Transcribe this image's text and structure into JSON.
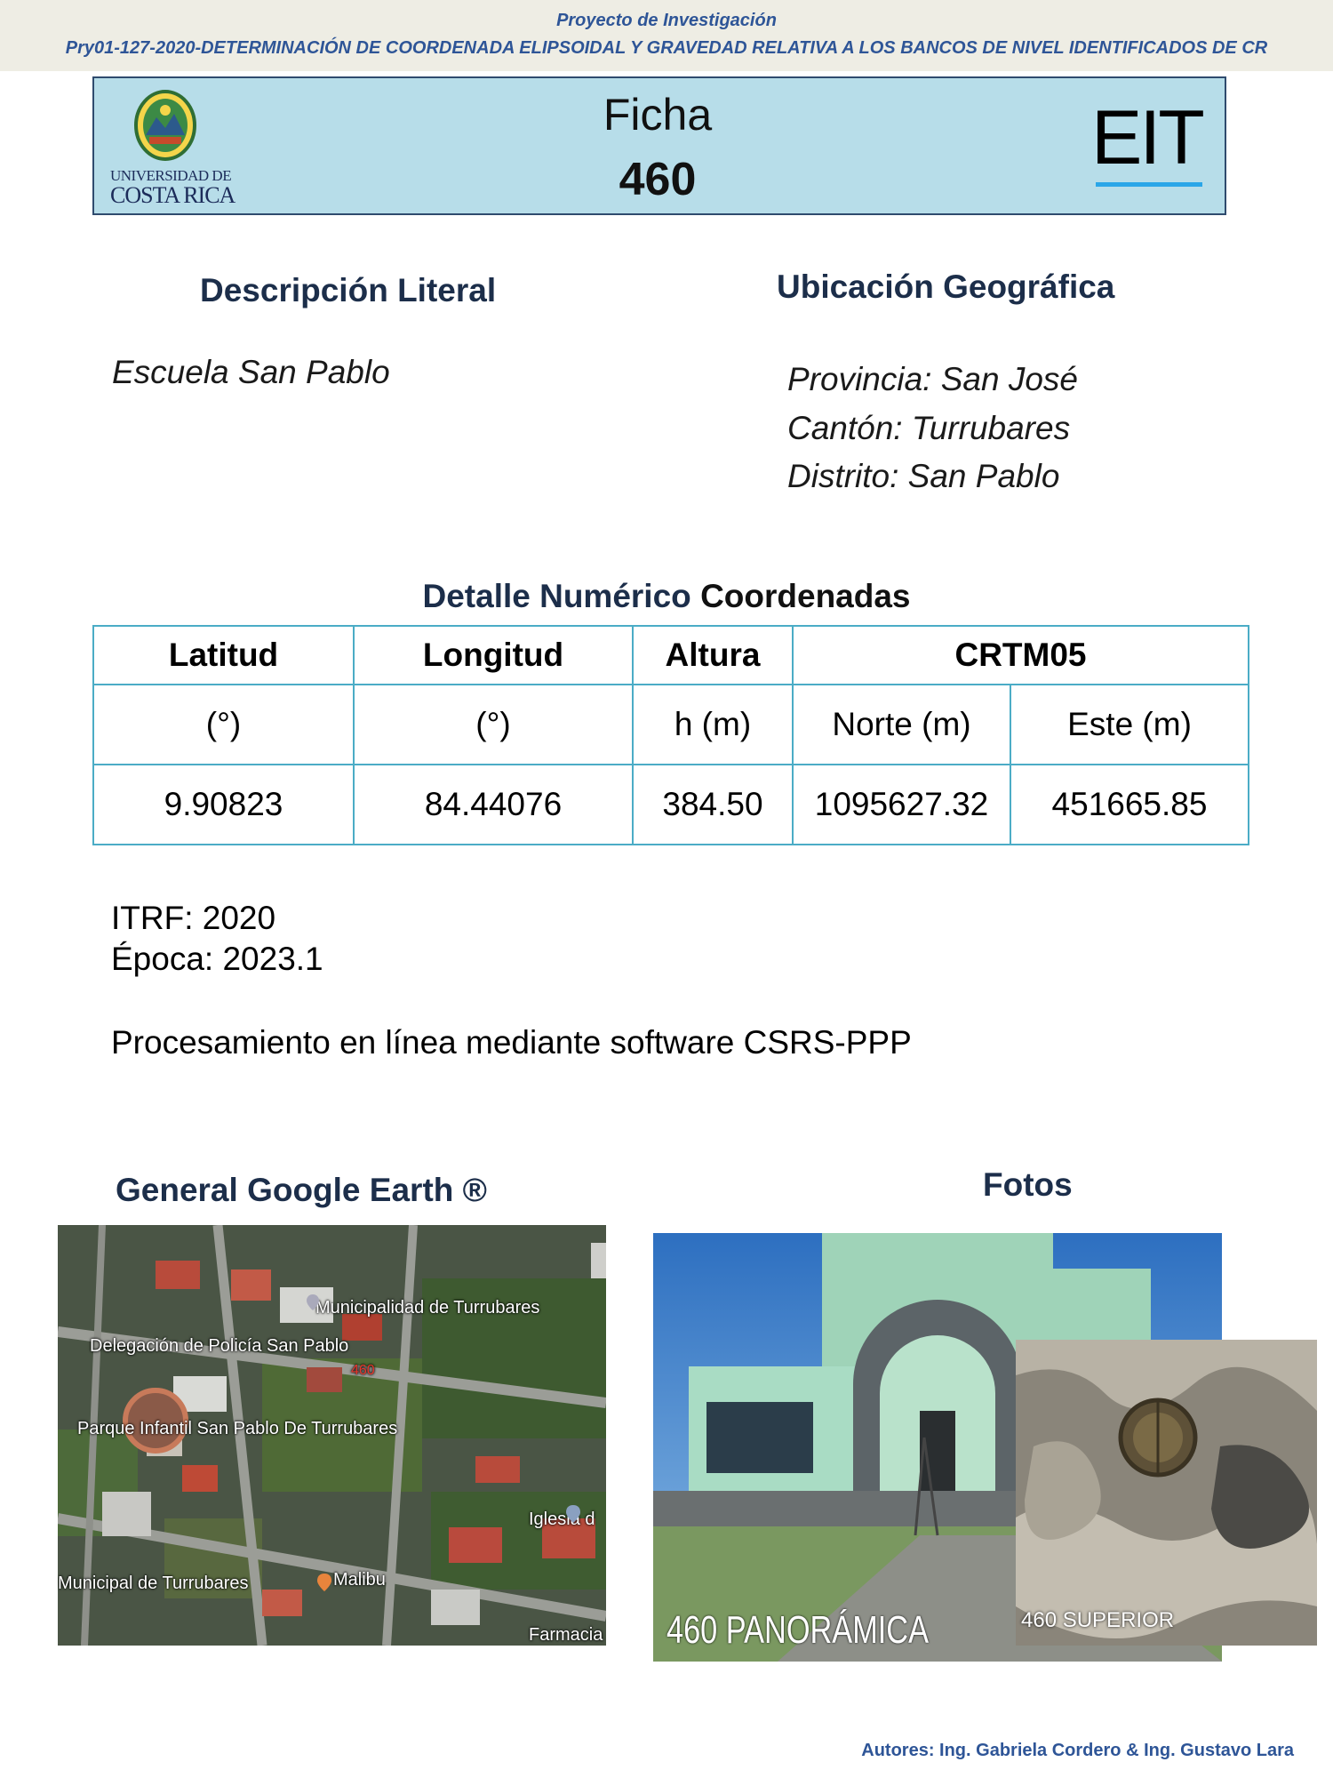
{
  "header": {
    "project_label": "Proyecto de Investigación",
    "project_title": "Pry01-127-2020-DETERMINACIÓN DE COORDENADA ELIPSOIDAL Y GRAVEDAD RELATIVA A LOS BANCOS DE NIVEL IDENTIFICADOS DE CR"
  },
  "ficha": {
    "university_line1": "UNIVERSIDAD DE",
    "university_line2": "COSTA RICA",
    "label": "Ficha",
    "number": "460",
    "brand": "EIT"
  },
  "descripcion": {
    "heading": "Descripción Literal",
    "text": "Escuela San Pablo"
  },
  "ubicacion": {
    "heading": "Ubicación Geográfica",
    "provincia": "Provincia: San José",
    "canton": "Cantón: Turrubares",
    "distrito": "Distrito: San Pablo"
  },
  "detalle": {
    "heading_part1": "Detalle Numérico",
    "heading_part2": "Coordenadas",
    "headers": [
      "Latitud",
      "Longitud",
      "Altura",
      "CRTM05"
    ],
    "units": [
      "(°)",
      "(°)",
      "h (m)",
      "Norte (m)",
      "Este (m)"
    ],
    "values": [
      "9.90823",
      "84.44076",
      "384.50",
      "1095627.32",
      "451665.85"
    ]
  },
  "meta": {
    "itrf": "ITRF: 2020",
    "epoca": "Época: 2023.1",
    "procesamiento": "Procesamiento en línea mediante software CSRS-PPP"
  },
  "google": {
    "heading": "General Google Earth ®",
    "labels": {
      "municipalidad": "Municipalidad de Turrubares",
      "delegacion": "Delegación de Policía San Pablo",
      "marker": "460",
      "parque": "Parque Infantil San Pablo De Turrubares",
      "iglesia": "Iglesia d",
      "municipal": "Municipal de Turrubares",
      "malibu": "Malibu",
      "farmacia": "Farmacia"
    }
  },
  "fotos": {
    "heading": "Fotos",
    "pano_caption": "460 PANORÁMICA",
    "top_caption": "460 SUPERIOR"
  },
  "footer": {
    "authors": "Autores: Ing. Gabriela Cordero & Ing. Gustavo Lara"
  },
  "colors": {
    "header_text": "#2e5597",
    "ficha_box": "#b7dde9",
    "table_border": "#4bacc6",
    "heading": "#1c2e4a",
    "eit_accent": "#2aa6e8"
  }
}
